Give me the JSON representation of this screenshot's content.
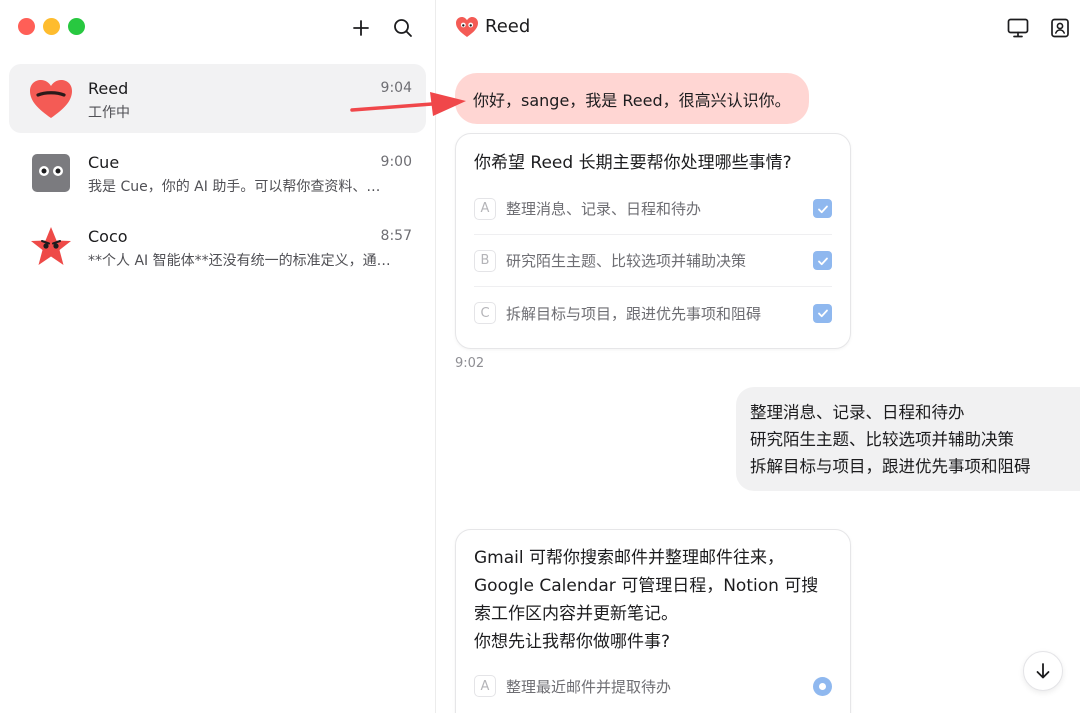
{
  "sidebar": {
    "conversations": [
      {
        "name": "Reed",
        "time": "9:04",
        "preview": "工作中",
        "avatar": "heart-avatar",
        "active": true
      },
      {
        "name": "Cue",
        "time": "9:00",
        "preview": "我是 Cue，你的 AI 助手。可以帮你查资料、…",
        "avatar": "robot-avatar",
        "active": false
      },
      {
        "name": "Coco",
        "time": "8:57",
        "preview": "**个人 AI 智能体**还没有统一的标准定义，通…",
        "avatar": "star-avatar",
        "active": false
      }
    ]
  },
  "header": {
    "title": "Reed",
    "title_icon": "heart-icon",
    "tools": [
      "monitor-icon",
      "contact-icon"
    ]
  },
  "chat": {
    "greeting": "你好，sange，我是 Reed，很高兴认识你。",
    "question1": {
      "prompt": "你希望 Reed 长期主要帮你处理哪些事情?",
      "options": [
        {
          "letter": "A",
          "label": "整理消息、记录、日程和待办",
          "checked": true
        },
        {
          "letter": "B",
          "label": "研究陌生主题、比较选项并辅助决策",
          "checked": true
        },
        {
          "letter": "C",
          "label": "拆解目标与项目，跟进优先事项和阻碍",
          "checked": true
        }
      ]
    },
    "timestamp": "9:02",
    "user_reply": [
      "整理消息、记录、日程和待办",
      "研究陌生主题、比较选项并辅助决策",
      "拆解目标与项目，跟进优先事项和阻碍"
    ],
    "question2": {
      "lines": [
        "Gmail 可帮你搜索邮件并整理邮件往来，",
        "Google Calendar 可管理日程，Notion 可搜",
        "索工作区内容并更新笔记。",
        "你想先让我帮你做哪件事?"
      ],
      "options": [
        {
          "letter": "A",
          "label": "整理最近邮件并提取待办",
          "selected": true
        }
      ]
    }
  },
  "colors": {
    "accent_blue": "#8fb8ef",
    "pink_bubble": "#ffd6d3",
    "arrow_red": "#f0474a"
  }
}
